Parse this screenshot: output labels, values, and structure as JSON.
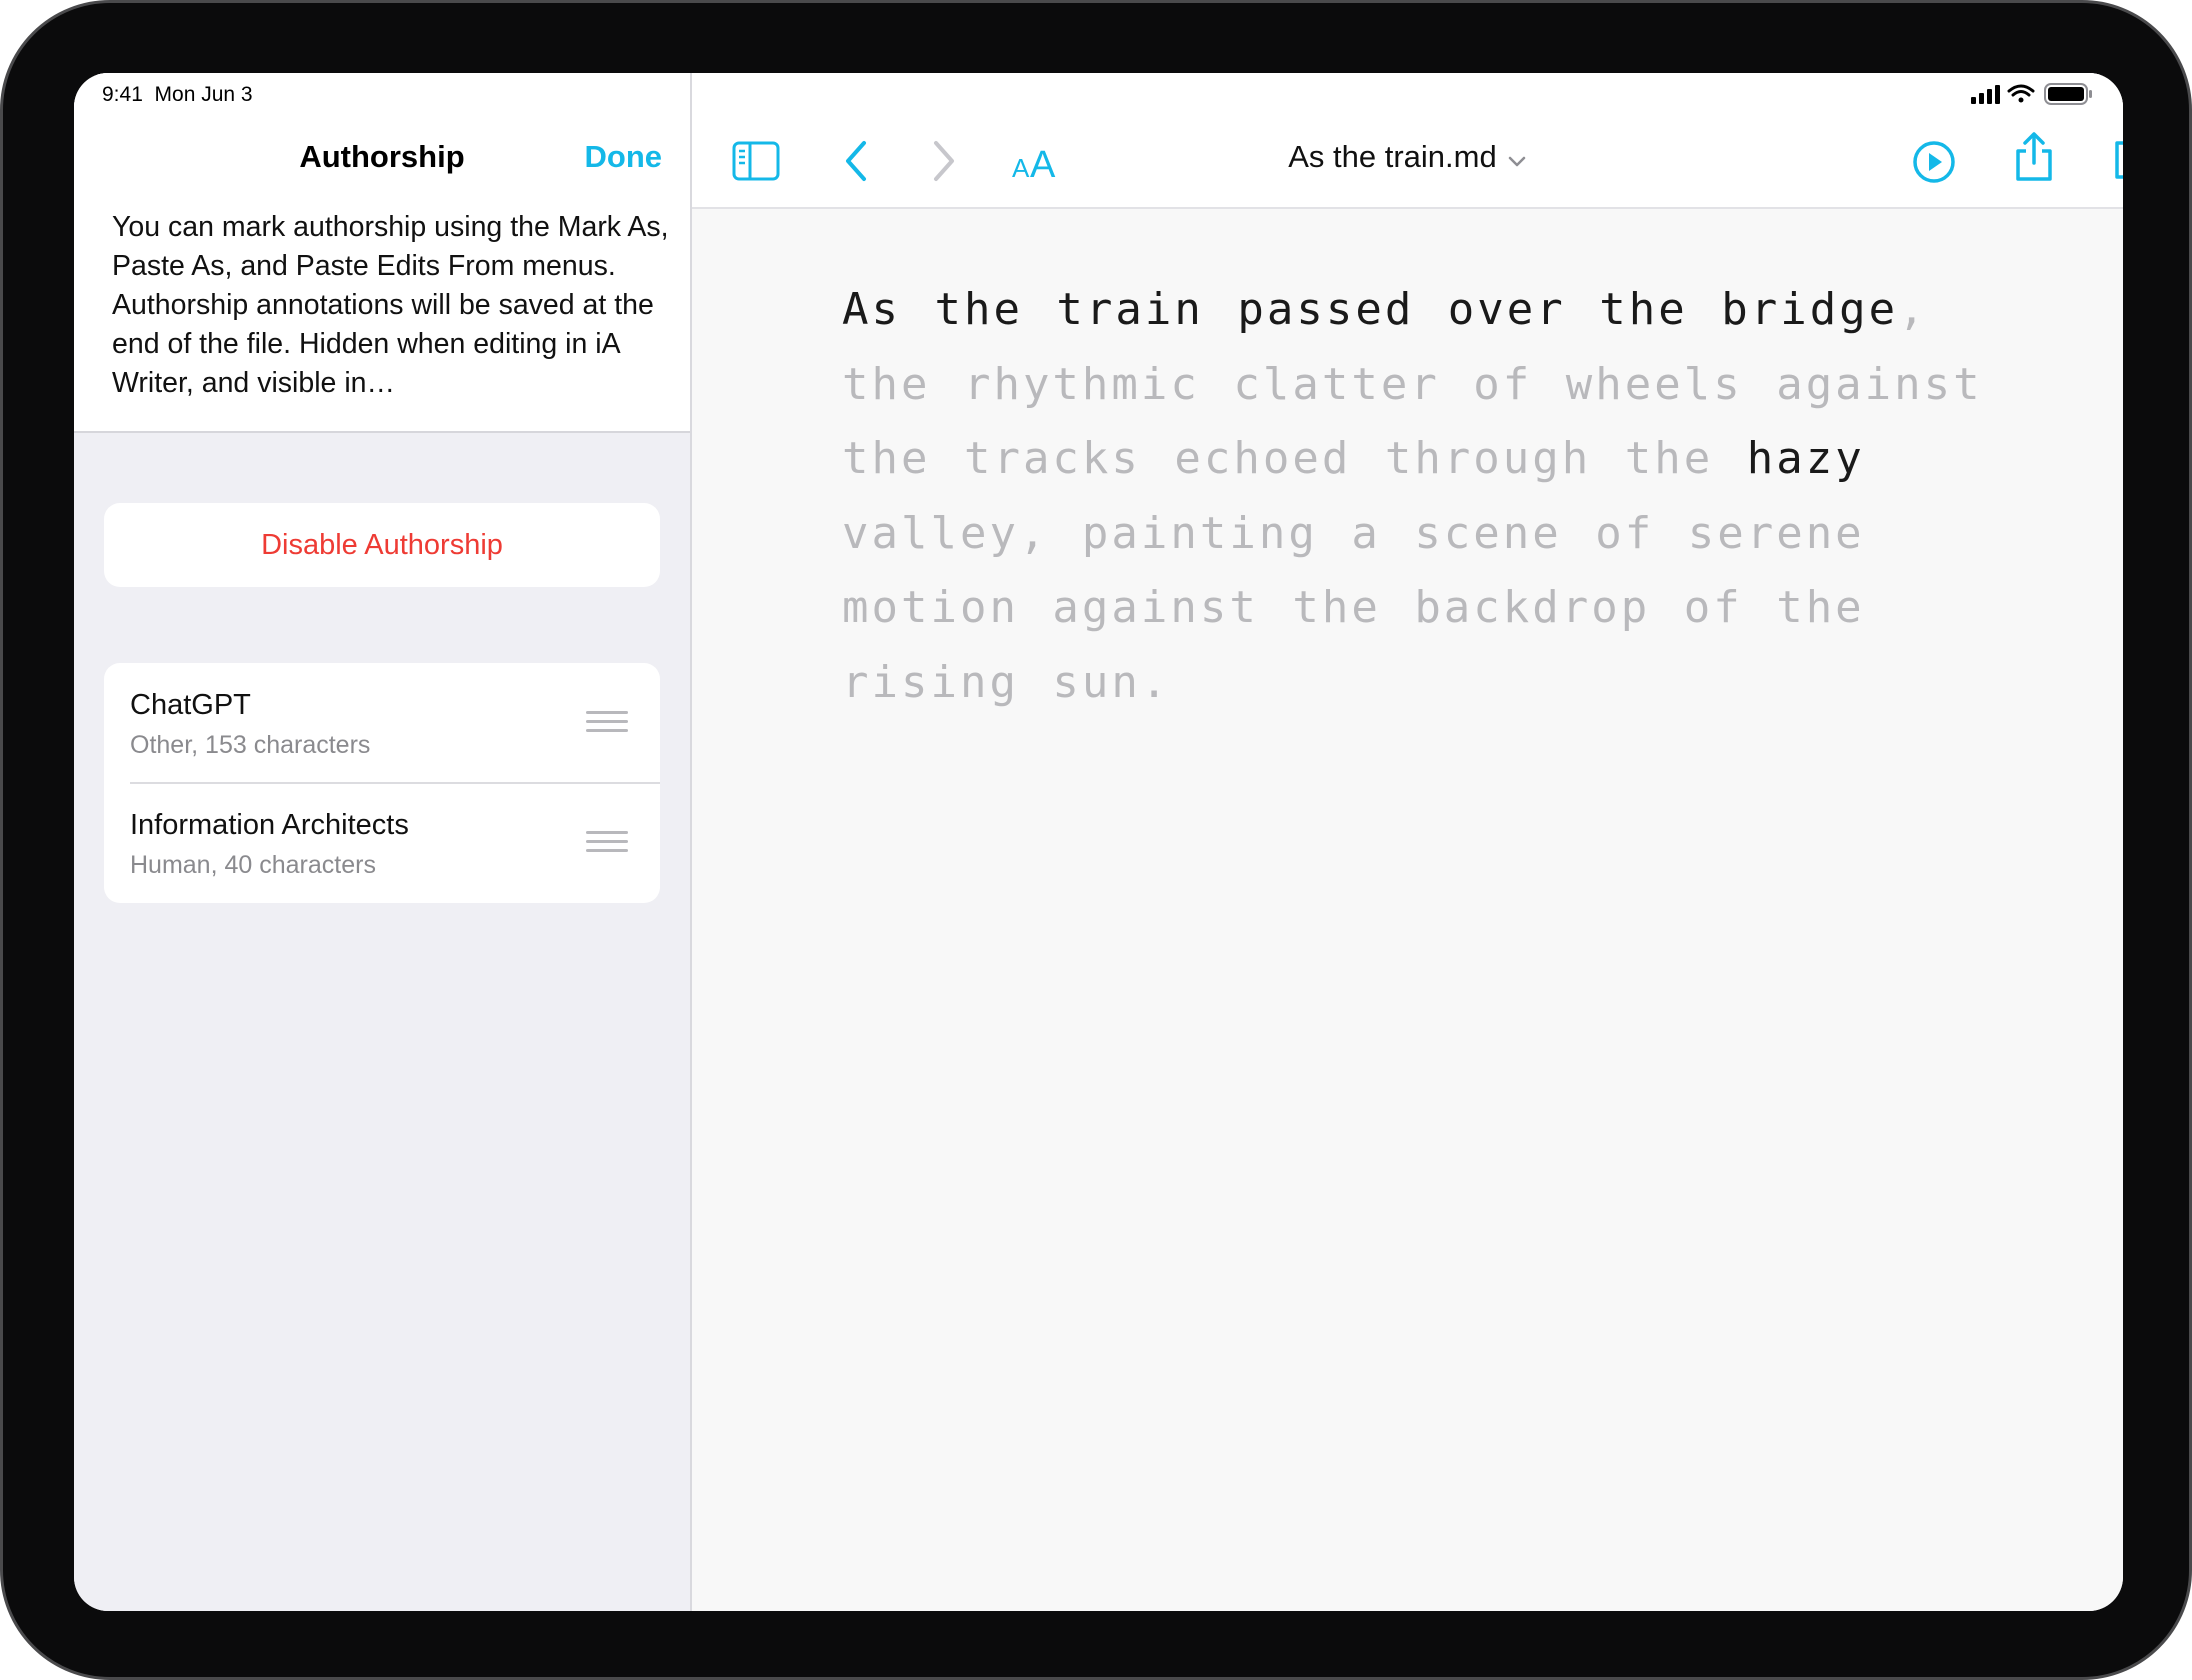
{
  "status_bar": {
    "time": "9:41",
    "date": "Mon Jun 3",
    "icons": [
      "cellular-signal-icon",
      "wifi-icon",
      "battery-icon"
    ]
  },
  "authorship_panel": {
    "title": "Authorship",
    "done_label": "Done",
    "description": "You can mark authorship using the Mark As, Paste As, and Paste Edits From menus. Authorship annotations will be saved at the end of the file. Hidden when editing in iA Writer, and visible in…",
    "disable_label": "Disable Authorship",
    "authors": [
      {
        "name": "ChatGPT",
        "meta": "Other, 153 characters"
      },
      {
        "name": "Information Architects",
        "meta": "Human, 40 characters"
      }
    ]
  },
  "editor": {
    "toolbar": {
      "icons": [
        "sidebar-toggle-icon",
        "back-chevron-icon",
        "forward-chevron-icon",
        "text-size-icon",
        "play-preview-icon",
        "share-icon",
        "compose-icon"
      ],
      "document_title": "As the train.md"
    },
    "document": {
      "segments": [
        {
          "text": "As the train passed over the bridge",
          "author": "human"
        },
        {
          "text": ", the rhythmic clatter of wheels against the tracks echoed through the ",
          "author": "other"
        },
        {
          "text": "hazy",
          "author": "human"
        },
        {
          "text": " valley, painting a scene of serene motion against the backdrop of the rising sun.",
          "author": "other"
        }
      ]
    }
  },
  "colors": {
    "accent": "#14b8e8",
    "destructive": "#ee3b34",
    "human_text": "#1a1a1a",
    "other_text": "#b9b9bc"
  }
}
